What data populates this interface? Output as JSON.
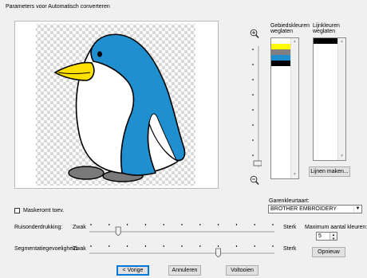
{
  "window": {
    "title": "Parameters voor Automatisch converteren"
  },
  "zoom": {
    "in_icon": "zoom-in-icon",
    "out_icon": "zoom-out-icon"
  },
  "area_colors": {
    "header": [
      "Gebiedskleuren",
      "weglaten"
    ],
    "swatches": [
      "#ffffff",
      "#ffff00",
      "#808080",
      "#1f8fcf",
      "#000000"
    ]
  },
  "line_colors": {
    "header": [
      "Lijnkleuren",
      "weglaten"
    ],
    "swatches": [
      "#000000"
    ]
  },
  "buttons": {
    "lines": "Lijnen maken...",
    "reset": "Opnieuw",
    "back": "< Vorige",
    "cancel": "Annuleren",
    "finish": "Voltooien"
  },
  "mask": {
    "label": "Maskeromt toev.",
    "checked": false
  },
  "thread": {
    "label": "Garenkleurtaart:",
    "value": "BROTHER EMBROIDERY"
  },
  "noise": {
    "label": "Ruisonderdrukking:",
    "min": "Zwak",
    "max": "Sterk",
    "level": 0.15
  },
  "segment": {
    "label": "Segmentatiegevoeligheid:",
    "min": "Zwak",
    "max": "Sterk",
    "level": 0.7
  },
  "max_colors": {
    "label": "Maximum aantal kleuren:",
    "value": "5"
  },
  "colors": {
    "penguin_blue": "#1f8fcf",
    "beak_yellow": "#ffe000",
    "feet_gray": "#7a7a7a"
  }
}
